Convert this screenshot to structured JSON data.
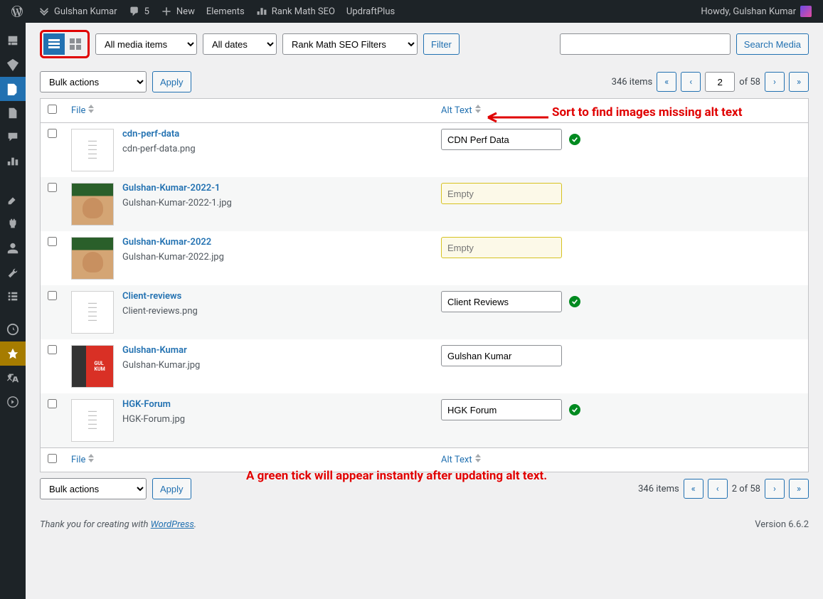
{
  "adminbar": {
    "site_name": "Gulshan Kumar",
    "comments": "5",
    "new": "New",
    "elements": "Elements",
    "rankmath": "Rank Math SEO",
    "updraft": "UpdraftPlus",
    "howdy": "Howdy, Gulshan Kumar"
  },
  "filters": {
    "media_type": "All media items",
    "dates": "All dates",
    "rankmath": "Rank Math SEO Filters",
    "filter_btn": "Filter",
    "search_btn": "Search Media"
  },
  "bulk": {
    "label": "Bulk actions",
    "apply": "Apply"
  },
  "paging": {
    "items_text": "346 items",
    "current": "2",
    "total_text": "of 58",
    "range_text": "2 of 58"
  },
  "cols": {
    "file": "File",
    "alt": "Alt Text"
  },
  "rows": [
    {
      "title": "cdn-perf-data",
      "filename": "cdn-perf-data.png",
      "alt": "CDN Perf Data",
      "empty": false,
      "tick": true,
      "thumb": "doc"
    },
    {
      "title": "Gulshan-Kumar-2022-1",
      "filename": "Gulshan-Kumar-2022-1.jpg",
      "alt": "",
      "placeholder": "Empty",
      "empty": true,
      "tick": false,
      "thumb": "face"
    },
    {
      "title": "Gulshan-Kumar-2022",
      "filename": "Gulshan-Kumar-2022.jpg",
      "alt": "",
      "placeholder": "Empty",
      "empty": true,
      "tick": false,
      "thumb": "face"
    },
    {
      "title": "Client-reviews",
      "filename": "Client-reviews.png",
      "alt": "Client Reviews",
      "empty": false,
      "tick": true,
      "thumb": "doc"
    },
    {
      "title": "Gulshan-Kumar",
      "filename": "Gulshan-Kumar.jpg",
      "alt": "Gulshan Kumar",
      "empty": false,
      "tick": false,
      "thumb": "gk"
    },
    {
      "title": "HGK-Forum",
      "filename": "HGK-Forum.jpg",
      "alt": "HGK Forum",
      "empty": false,
      "tick": true,
      "thumb": "doc"
    }
  ],
  "annotations": {
    "sort": "Sort to find images missing alt text",
    "tick": "A green tick will appear instantly after updating alt text."
  },
  "footer": {
    "thank": "Thank you for creating with ",
    "wp": "WordPress",
    "version": "Version 6.6.2"
  }
}
